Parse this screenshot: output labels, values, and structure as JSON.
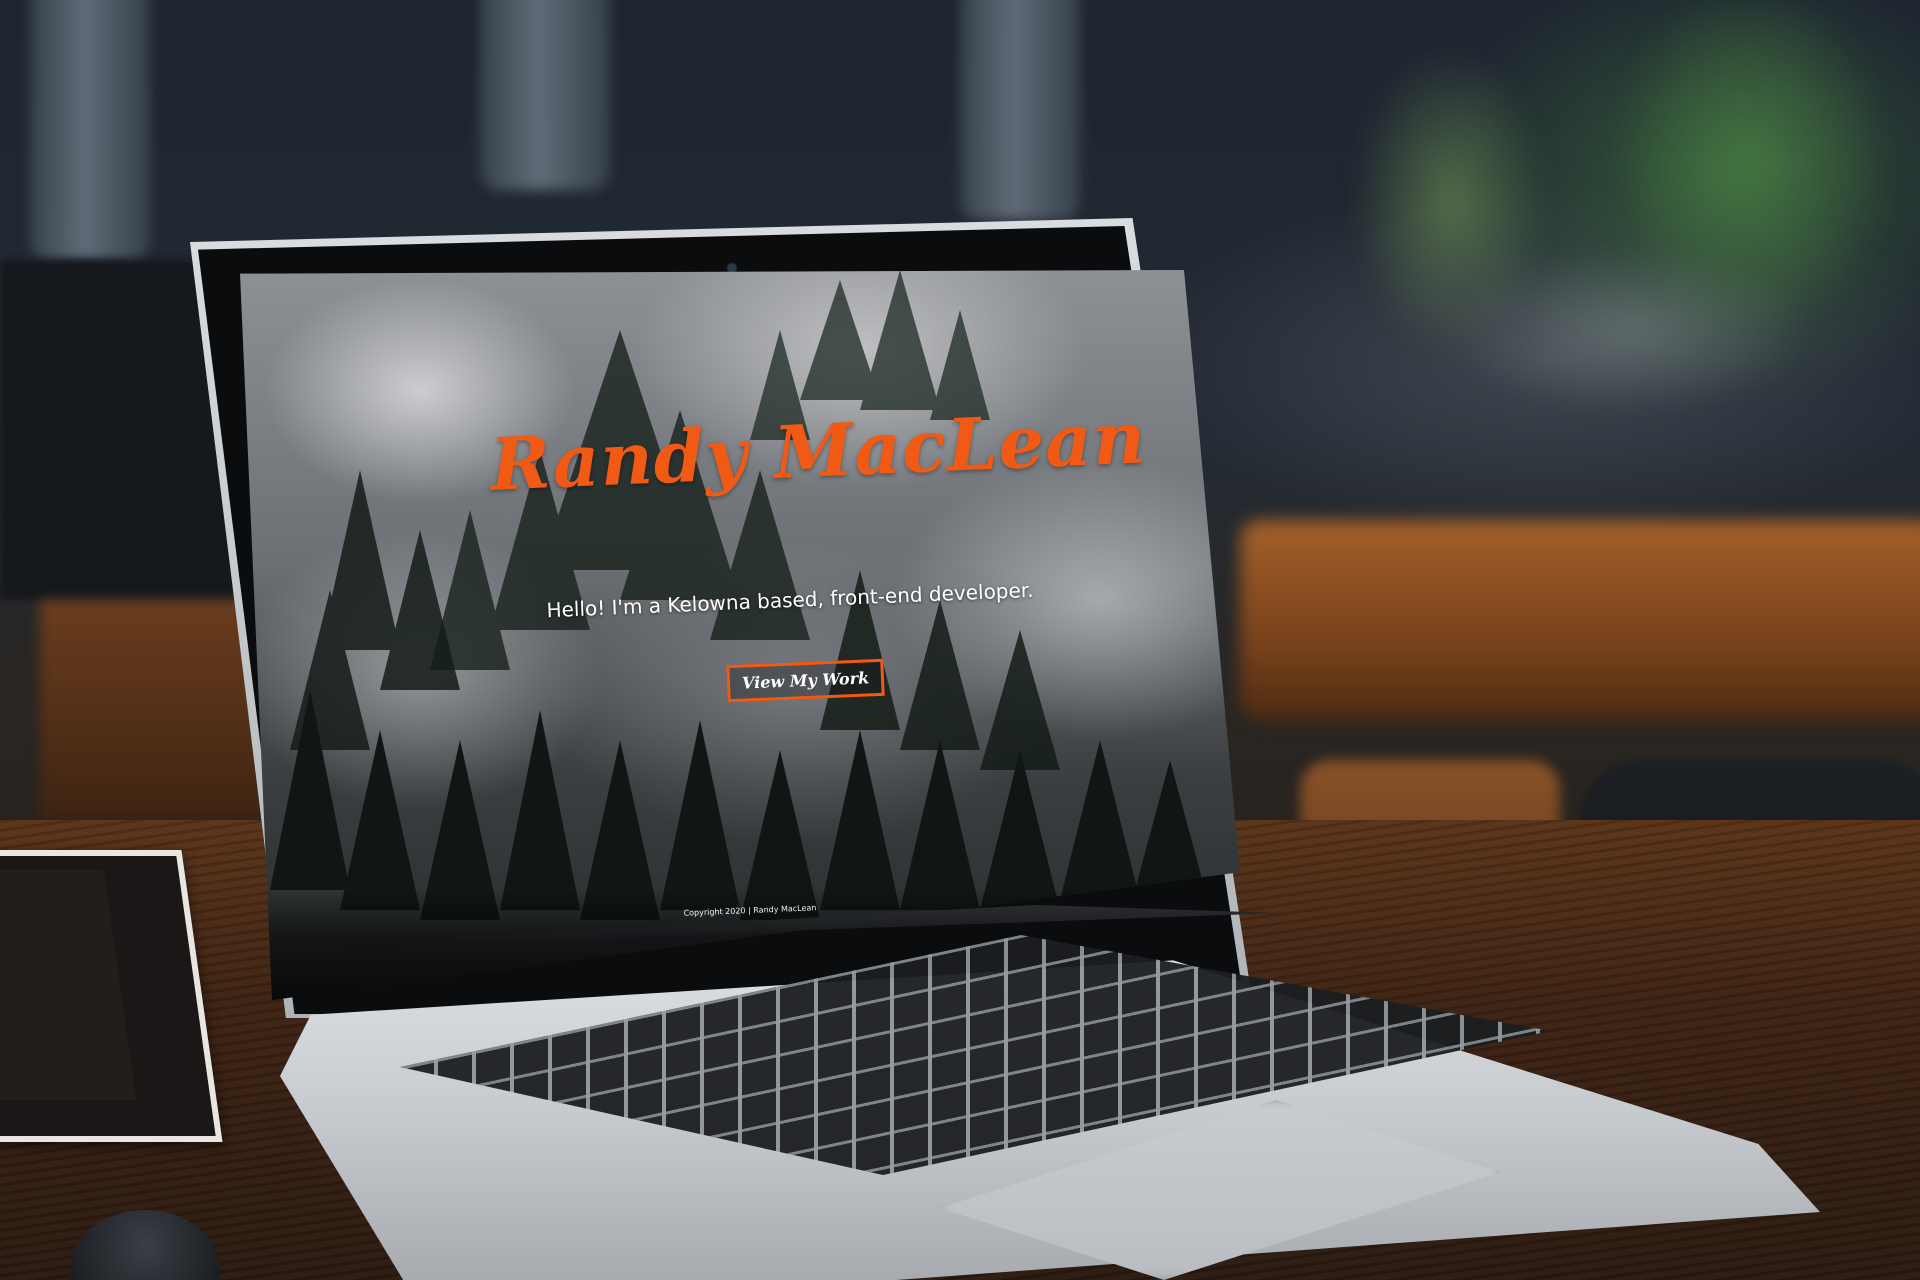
{
  "site": {
    "title": "Randy MacLean",
    "tagline": "Hello! I'm a Kelowna based, front-end developer.",
    "cta_label": "View My Work",
    "footer": "Copyright 2020 | Randy MacLean"
  },
  "colors": {
    "accent": "#f05a14",
    "text": "#ffffff"
  }
}
